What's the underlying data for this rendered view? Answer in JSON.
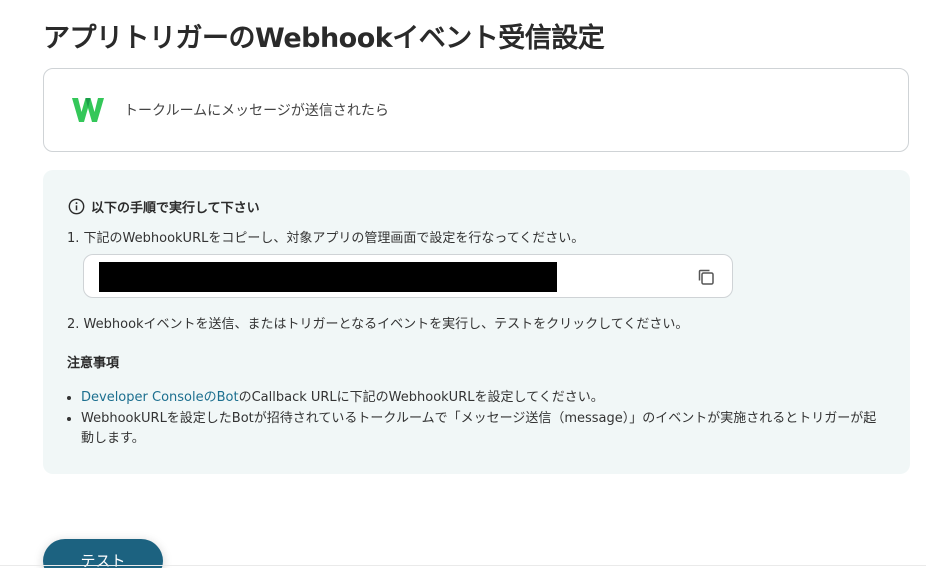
{
  "page": {
    "title": "アプリトリガーのWebhookイベント受信設定"
  },
  "trigger": {
    "app_logo": "webhook-w-logo",
    "label": "トークルームにメッセージが送信されたら"
  },
  "instructions": {
    "heading_icon": "info-circle-icon",
    "heading": "以下の手順で実行して下さい",
    "step1": "1. 下記のWebhookURLをコピーし、対象アプリの管理画面で設定を行なってください。",
    "url_value": "",
    "copy_icon": "copy-icon",
    "step2": "2. Webhookイベントを送信、またはトリガーとなるイベントを実行し、テストをクリックしてください。"
  },
  "notes": {
    "heading": "注意事項",
    "items": [
      {
        "link_text": "Developer ConsoleのBot",
        "text": "のCallback URLに下記のWebhookURLを設定してください。"
      },
      {
        "text": "WebhookURLを設定したBotが招待されているトークルームで「メッセージ送信（message）」のイベントが実施されるとトリガーが起動します。"
      }
    ]
  },
  "actions": {
    "test_label": "テスト"
  },
  "colors": {
    "accent": "#1c6280",
    "link": "#1c6f8f",
    "panel_bg": "#f1f7f7",
    "logo_green": "#34c759"
  }
}
